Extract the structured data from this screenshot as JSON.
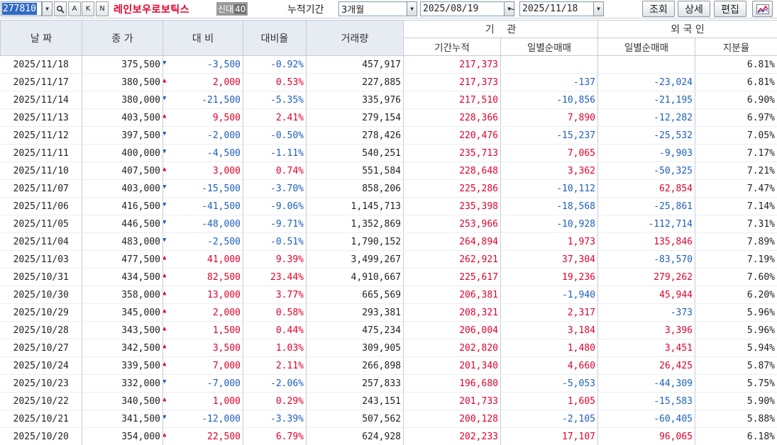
{
  "toolbar": {
    "code": "277810",
    "btn_a": "A",
    "btn_k": "K",
    "btn_n": "N",
    "stock_name": "레인보우로보틱스",
    "badge_label": "신대",
    "badge_num": "40",
    "period_label": "누적기간",
    "period_value": "3개월",
    "date_from": "2025/08/19",
    "tilde": "~",
    "date_to": "2025/11/18",
    "query_label": "조회",
    "detail_label": "상세",
    "edit_label": "편집"
  },
  "headers": {
    "date": "날 짜",
    "close": "종 가",
    "change": "대 비",
    "rate": "대비율",
    "volume": "거래량",
    "inst_group": "기    관",
    "inst_cum": "기간누적",
    "inst_daily": "일별순매매",
    "foreign_group": "외 국 인",
    "foreign_daily": "일별순매매",
    "foreign_share": "지분율"
  },
  "colors": {
    "up": "#e4002b",
    "down": "#1e5fbe",
    "header_bg": "#e7ebf2",
    "selection": "#316ac5"
  },
  "rows": [
    {
      "date": "2025/11/18",
      "close": "375,500",
      "dir": "down",
      "change": "-3,500",
      "rate": "-0.92%",
      "volume": "457,917",
      "inst_cum": "217,373",
      "inst_daily": "",
      "foreign_daily": "",
      "foreign_share": "6.81%"
    },
    {
      "date": "2025/11/17",
      "close": "380,500",
      "dir": "up",
      "change": "2,000",
      "rate": "0.53%",
      "volume": "227,885",
      "inst_cum": "217,373",
      "inst_daily": "-137",
      "foreign_daily": "-23,024",
      "foreign_share": "6.81%"
    },
    {
      "date": "2025/11/14",
      "close": "380,000",
      "dir": "down",
      "change": "-21,500",
      "rate": "-5.35%",
      "volume": "335,976",
      "inst_cum": "217,510",
      "inst_daily": "-10,856",
      "foreign_daily": "-21,195",
      "foreign_share": "6.90%"
    },
    {
      "date": "2025/11/13",
      "close": "403,500",
      "dir": "up",
      "change": "9,500",
      "rate": "2.41%",
      "volume": "279,154",
      "inst_cum": "228,366",
      "inst_daily": "7,890",
      "foreign_daily": "-12,282",
      "foreign_share": "6.97%"
    },
    {
      "date": "2025/11/12",
      "close": "397,500",
      "dir": "down",
      "change": "-2,000",
      "rate": "-0.50%",
      "volume": "278,426",
      "inst_cum": "220,476",
      "inst_daily": "-15,237",
      "foreign_daily": "-25,532",
      "foreign_share": "7.05%"
    },
    {
      "date": "2025/11/11",
      "close": "400,000",
      "dir": "down",
      "change": "-4,500",
      "rate": "-1.11%",
      "volume": "540,251",
      "inst_cum": "235,713",
      "inst_daily": "7,065",
      "foreign_daily": "-9,903",
      "foreign_share": "7.17%"
    },
    {
      "date": "2025/11/10",
      "close": "407,500",
      "dir": "up",
      "change": "3,000",
      "rate": "0.74%",
      "volume": "551,584",
      "inst_cum": "228,648",
      "inst_daily": "3,362",
      "foreign_daily": "-50,325",
      "foreign_share": "7.21%"
    },
    {
      "date": "2025/11/07",
      "close": "403,000",
      "dir": "down",
      "change": "-15,500",
      "rate": "-3.70%",
      "volume": "858,206",
      "inst_cum": "225,286",
      "inst_daily": "-10,112",
      "foreign_daily": "62,854",
      "foreign_share": "7.47%"
    },
    {
      "date": "2025/11/06",
      "close": "416,500",
      "dir": "down",
      "change": "-41,500",
      "rate": "-9.06%",
      "volume": "1,145,713",
      "inst_cum": "235,398",
      "inst_daily": "-18,568",
      "foreign_daily": "-25,861",
      "foreign_share": "7.14%"
    },
    {
      "date": "2025/11/05",
      "close": "446,500",
      "dir": "down",
      "change": "-48,000",
      "rate": "-9.71%",
      "volume": "1,352,869",
      "inst_cum": "253,966",
      "inst_daily": "-10,928",
      "foreign_daily": "-112,714",
      "foreign_share": "7.31%"
    },
    {
      "date": "2025/11/04",
      "close": "483,000",
      "dir": "down",
      "change": "-2,500",
      "rate": "-0.51%",
      "volume": "1,790,152",
      "inst_cum": "264,894",
      "inst_daily": "1,973",
      "foreign_daily": "135,846",
      "foreign_share": "7.89%"
    },
    {
      "date": "2025/11/03",
      "close": "477,500",
      "dir": "up",
      "change": "41,000",
      "rate": "9.39%",
      "volume": "3,499,267",
      "inst_cum": "262,921",
      "inst_daily": "37,304",
      "foreign_daily": "-83,570",
      "foreign_share": "7.19%"
    },
    {
      "date": "2025/10/31",
      "close": "434,500",
      "dir": "up",
      "change": "82,500",
      "rate": "23.44%",
      "volume": "4,910,667",
      "inst_cum": "225,617",
      "inst_daily": "19,236",
      "foreign_daily": "279,262",
      "foreign_share": "7.60%"
    },
    {
      "date": "2025/10/30",
      "close": "358,000",
      "dir": "up",
      "change": "13,000",
      "rate": "3.77%",
      "volume": "665,569",
      "inst_cum": "206,381",
      "inst_daily": "-1,940",
      "foreign_daily": "45,944",
      "foreign_share": "6.20%"
    },
    {
      "date": "2025/10/29",
      "close": "345,000",
      "dir": "up",
      "change": "2,000",
      "rate": "0.58%",
      "volume": "293,381",
      "inst_cum": "208,321",
      "inst_daily": "2,317",
      "foreign_daily": "-373",
      "foreign_share": "5.96%"
    },
    {
      "date": "2025/10/28",
      "close": "343,500",
      "dir": "up",
      "change": "1,500",
      "rate": "0.44%",
      "volume": "475,234",
      "inst_cum": "206,004",
      "inst_daily": "3,184",
      "foreign_daily": "3,396",
      "foreign_share": "5.96%"
    },
    {
      "date": "2025/10/27",
      "close": "342,500",
      "dir": "up",
      "change": "3,500",
      "rate": "1.03%",
      "volume": "309,905",
      "inst_cum": "202,820",
      "inst_daily": "1,480",
      "foreign_daily": "3,451",
      "foreign_share": "5.94%"
    },
    {
      "date": "2025/10/24",
      "close": "339,500",
      "dir": "up",
      "change": "7,000",
      "rate": "2.11%",
      "volume": "266,898",
      "inst_cum": "201,340",
      "inst_daily": "4,660",
      "foreign_daily": "26,425",
      "foreign_share": "5.87%"
    },
    {
      "date": "2025/10/23",
      "close": "332,000",
      "dir": "down",
      "change": "-7,000",
      "rate": "-2.06%",
      "volume": "257,833",
      "inst_cum": "196,680",
      "inst_daily": "-5,053",
      "foreign_daily": "-44,309",
      "foreign_share": "5.75%"
    },
    {
      "date": "2025/10/22",
      "close": "340,500",
      "dir": "up",
      "change": "1,000",
      "rate": "0.29%",
      "volume": "243,151",
      "inst_cum": "201,733",
      "inst_daily": "1,605",
      "foreign_daily": "-15,583",
      "foreign_share": "5.90%"
    },
    {
      "date": "2025/10/21",
      "close": "341,500",
      "dir": "down",
      "change": "-12,000",
      "rate": "-3.39%",
      "volume": "507,562",
      "inst_cum": "200,128",
      "inst_daily": "-2,105",
      "foreign_daily": "-60,405",
      "foreign_share": "5.88%"
    },
    {
      "date": "2025/10/20",
      "close": "354,000",
      "dir": "up",
      "change": "22,500",
      "rate": "6.79%",
      "volume": "624,928",
      "inst_cum": "202,233",
      "inst_daily": "17,107",
      "foreign_daily": "96,065",
      "foreign_share": "6.18%"
    }
  ]
}
